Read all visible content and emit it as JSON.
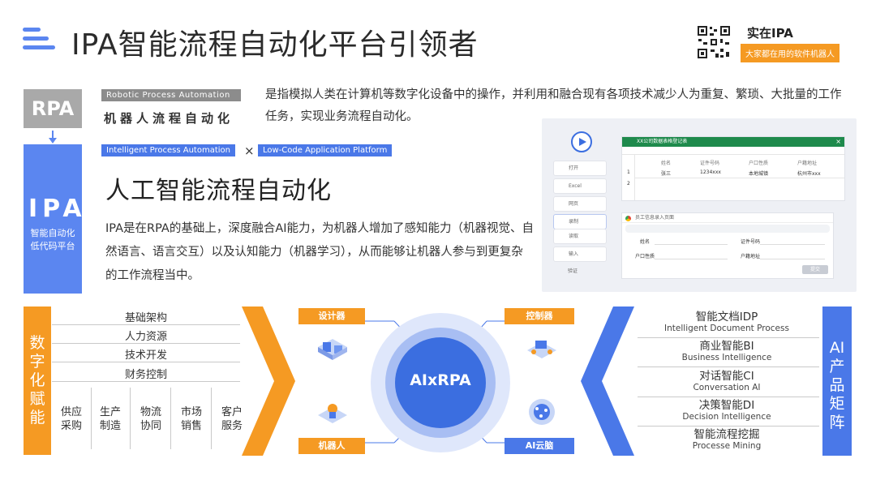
{
  "header": {
    "title": "IPA智能流程自动化平台引领者",
    "brand_name": "实在IPA",
    "brand_tagline": "大家都在用的软件机器人"
  },
  "rpa": {
    "label": "RPA",
    "en_tag": "Robotic Process Automation",
    "cn_name": "机器人流程自动化",
    "description": "是指模拟人类在计算机等数字化设备中的操作，并利用和融合现有各项技术减少人为重复、繁琐、大批量的工作任务，实现业务流程自动化。"
  },
  "ipa": {
    "label": "IPA",
    "sub1": "智能自动化",
    "sub2": "低代码平台",
    "tag1": "Intelligent Process Automation",
    "times": "×",
    "tag2": "Low-Code Application Platform",
    "title": "人工智能流程自动化",
    "description": "IPA是在RPA的基础上，深度融合AI能力，为机器人增加了感知能力（机器视觉、自然语言、语言交互）以及认知能力（机器学习），从而能够让机器人参与到更复杂的工作流程当中。"
  },
  "mock": {
    "sidebar": [
      "打开",
      "Excel",
      "网页",
      "录制",
      "读取",
      "输入",
      "验证"
    ],
    "excel_title": "XX公司数据表格登记表",
    "excel_headers": [
      "姓名",
      "证件号码",
      "户口性质",
      "户籍地址"
    ],
    "excel_row": [
      "张三",
      "1234xxx",
      "本地城镇",
      "杭州市xxx"
    ],
    "row_nums": [
      "1",
      "2"
    ],
    "form_title": "员工信息录入页面",
    "form_fields": [
      "姓名",
      "证件号码",
      "户口性质",
      "户籍地址"
    ],
    "form_button": "提交"
  },
  "digital": {
    "label": "数字化赋能",
    "rows": [
      "基础架构",
      "人力资源",
      "技术开发",
      "财务控制"
    ],
    "cols": [
      {
        "l1": "供应",
        "l2": "采购"
      },
      {
        "l1": "生产",
        "l2": "制造"
      },
      {
        "l1": "物流",
        "l2": "协同"
      },
      {
        "l1": "市场",
        "l2": "销售"
      },
      {
        "l1": "客户",
        "l2": "服务"
      }
    ]
  },
  "center": {
    "label": "AIxRPA",
    "designer": "设计器",
    "robot": "机器人",
    "controller": "控制器",
    "ai_cloud": "AI云脑"
  },
  "ai_products": {
    "label": "AI产品矩阵",
    "items": [
      {
        "cn": "智能文档IDP",
        "en": "Intelligent Document Process"
      },
      {
        "cn": "商业智能BI",
        "en": "Business Intelligence"
      },
      {
        "cn": "对话智能CI",
        "en": "Conversation AI"
      },
      {
        "cn": "决策智能DI",
        "en": "Decision Intelligence"
      },
      {
        "cn": "智能流程挖掘",
        "en": "Processe Mining"
      }
    ]
  },
  "colors": {
    "orange": "#f59a23",
    "blue": "#4a78e8",
    "gray": "#a9a9a9"
  }
}
